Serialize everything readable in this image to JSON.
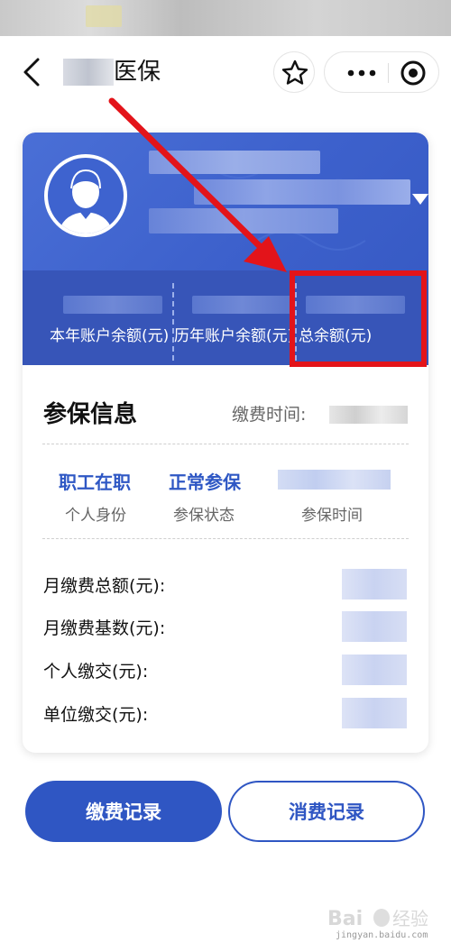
{
  "nav": {
    "title_suffix": "医保"
  },
  "card": {
    "balances": [
      {
        "label": "本年账户余额(元)"
      },
      {
        "label": "历年账户余额(元)"
      },
      {
        "label": "总余额(元)"
      }
    ],
    "section_title": "参保信息",
    "pay_time_label": "缴费时间:",
    "stats": [
      {
        "value": "职工在职",
        "label": "个人身份"
      },
      {
        "value": "正常参保",
        "label": "参保状态"
      },
      {
        "label": "参保时间"
      }
    ],
    "rows": [
      {
        "label": "月缴费总额(元):"
      },
      {
        "label": "月缴费基数(元):"
      },
      {
        "label": "个人缴交(元):"
      },
      {
        "label": "单位缴交(元):"
      }
    ]
  },
  "buttons": {
    "payment_records": "缴费记录",
    "consumption_records": "消费记录"
  },
  "watermark": {
    "text": "jingyan.baidu.com"
  },
  "colors": {
    "brand_blue": "#2f56c3",
    "card_blue": "#3d61cc",
    "annotation_red": "#e3141a"
  }
}
